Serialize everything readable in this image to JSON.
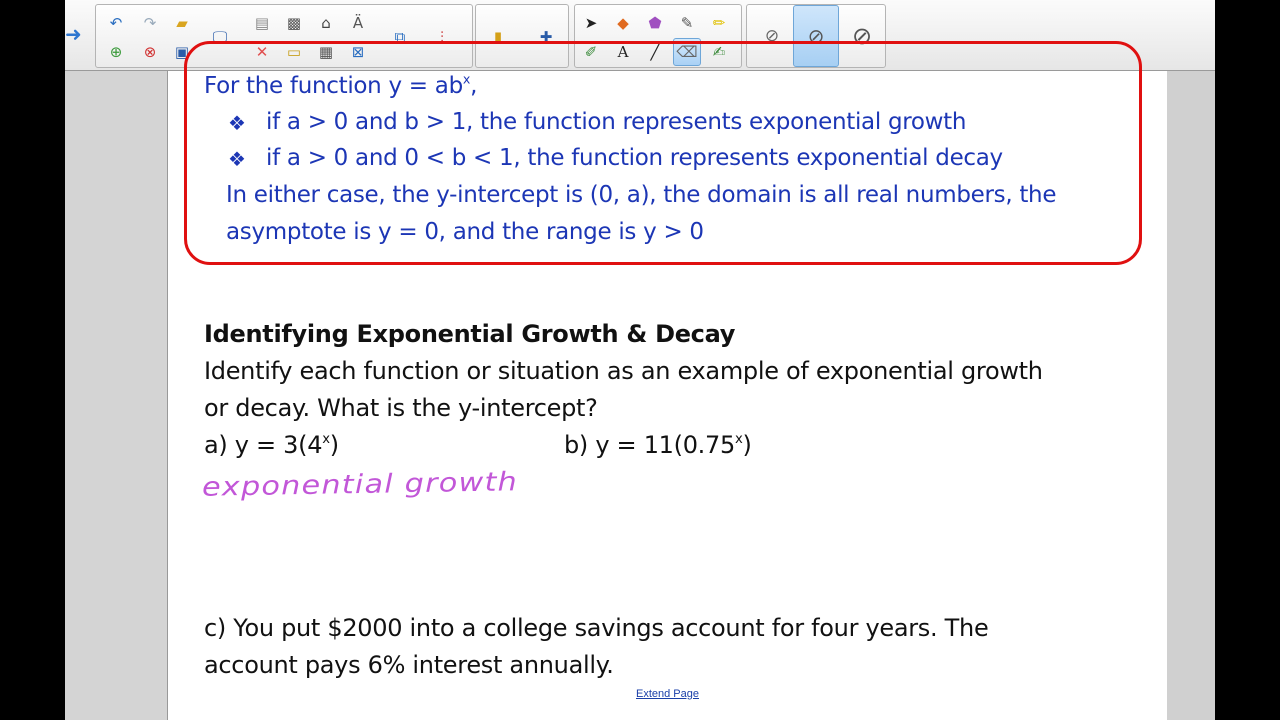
{
  "toolbar": {
    "groups": [
      {
        "name": "edit",
        "icons": [
          "undo-icon",
          "redo-icon",
          "open-icon",
          "new-page-icon",
          "delete-page-icon",
          "save-icon",
          "screen-icon",
          "paste-icon",
          "clear-icon",
          "screen-capture-icon",
          "table-icon",
          "full-screen-icon",
          "document-camera-icon",
          "spell-icon",
          "record-icon",
          "display-icon"
        ]
      },
      {
        "name": "insert",
        "icons": [
          "properties-icon",
          "addons-icon"
        ]
      },
      {
        "name": "tools",
        "icons": [
          "select-icon",
          "fill-icon",
          "shapes-icon",
          "magic-pen-icon",
          "highlighter-icon",
          "pens-icon",
          "text-icon",
          "line-icon",
          "eraser-icon",
          "measure-pen-icon"
        ]
      },
      {
        "name": "eraser-sizes",
        "icons": [
          "eraser-small-icon",
          "eraser-medium-icon",
          "eraser-large-icon"
        ]
      }
    ]
  },
  "box": {
    "line1_prefix": "For the function y = ab",
    "line1_sup": "x",
    "line1_suffix": ",",
    "bullet1": "if a > 0 and b > 1, the function represents exponential growth",
    "bullet2": "if a > 0 and 0 < b < 1, the function represents exponential decay",
    "line4": "In either case, the y-intercept  is (0, a), the domain is all real numbers, the",
    "line5": "asymptote is y = 0, and the range is y > 0"
  },
  "section": {
    "heading": "Identifying Exponential Growth & Decay",
    "line1": "Identify each function or situation as an example of exponential growth",
    "line2": "or decay. What is the y-intercept?",
    "a_prefix": "a)  y = 3(4",
    "a_sup": "x",
    "a_suffix": ")",
    "b_prefix": "b)  y = 11(0.75",
    "b_sup": "x",
    "b_suffix": ")",
    "handwriting": "exponential growth",
    "c_line1": "c)  You put $2000 into a college savings account for four years. The",
    "c_line2": "account pays 6% interest annually."
  },
  "extend_link": "Extend Page",
  "colors": {
    "box_border": "#e01010",
    "box_text": "#1c36b5",
    "handwriting": "#c257d8",
    "link": "#1a3fa8"
  }
}
